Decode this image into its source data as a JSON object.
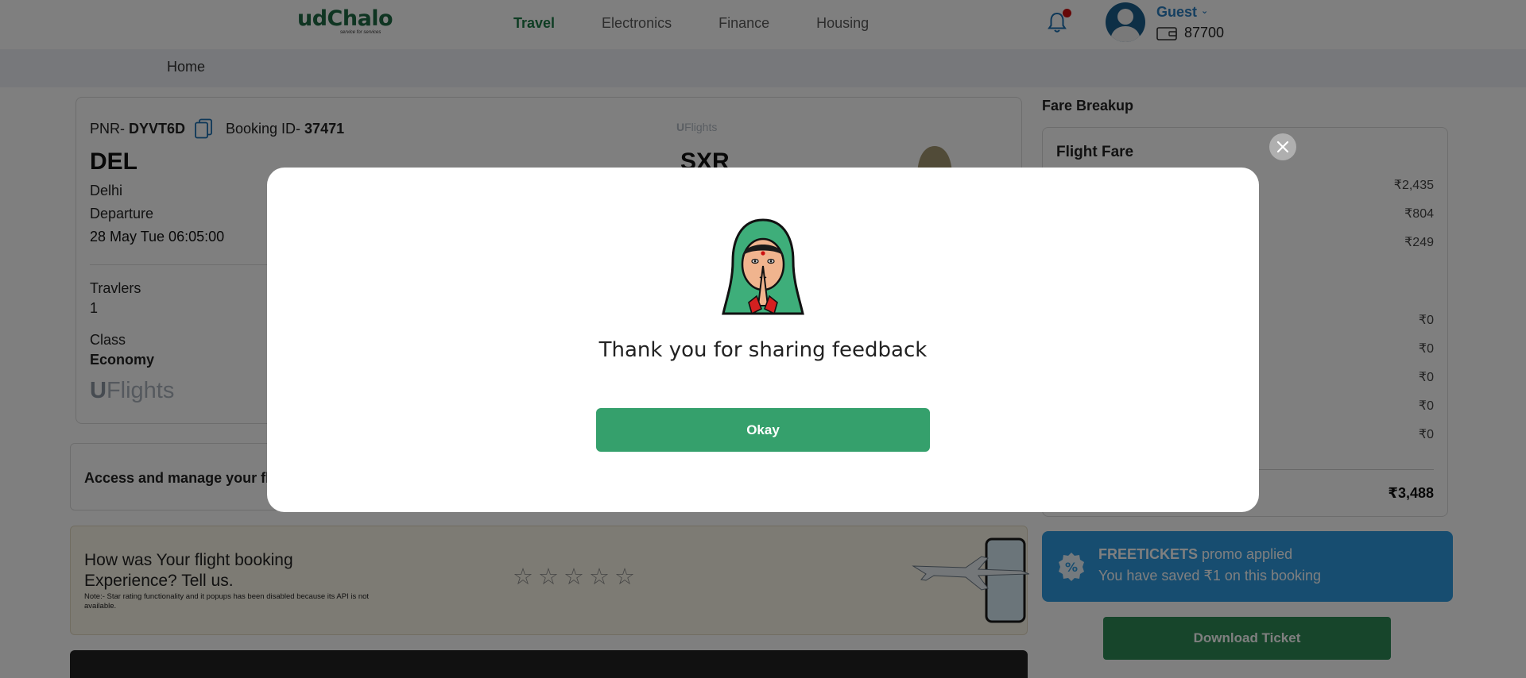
{
  "brand": {
    "name": "udChalo",
    "tagline": "service for services"
  },
  "nav": {
    "items": [
      "Travel",
      "Electronics",
      "Finance",
      "Housing"
    ],
    "active": "Travel"
  },
  "user": {
    "name": "Guest",
    "wallet_balance": "87700"
  },
  "breadcrumb": {
    "home": "Home"
  },
  "booking": {
    "pnr_label": "PNR- ",
    "pnr": "DYVT6D",
    "booking_id_label": "Booking ID- ",
    "booking_id": "37471",
    "from_code": "DEL",
    "from_city": "Delhi",
    "departure_label": "Departure",
    "departure_datetime": "28 May Tue 06:05:00",
    "to_code": "SXR",
    "travelers_label": "Travlers",
    "travelers": "1",
    "class_label": "Class",
    "class": "Economy",
    "airline_logo_u": "U",
    "airline_logo_text": "Flights"
  },
  "manage": {
    "text": "Access and manage your fli"
  },
  "feedback": {
    "title": "How was Your flight booking Experience? Tell us.",
    "note": "Note:- Star rating functionality and it popups has been disabled because its API is not available.",
    "stars": [
      "☆",
      "☆",
      "☆",
      "☆",
      "☆"
    ]
  },
  "fare": {
    "title": "Fare Breakup",
    "subtitle": "Flight Fare",
    "values": [
      "₹2,435",
      "₹804",
      "₹249",
      "₹0",
      "₹0",
      "₹0",
      "₹0",
      "₹0"
    ],
    "total": "₹3,488"
  },
  "promo": {
    "code": "FREETICKETS",
    "applied_text": " promo applied",
    "saved_text": "You have saved ₹1 on this booking"
  },
  "download_label": "Download Ticket",
  "modal": {
    "message": "Thank you for sharing feedback",
    "okay_label": "Okay"
  },
  "colors": {
    "brand_green": "#1f6b45",
    "button_green": "#35a06c",
    "promo_blue": "#2f9ae0",
    "link_blue": "#2a7ec0"
  }
}
